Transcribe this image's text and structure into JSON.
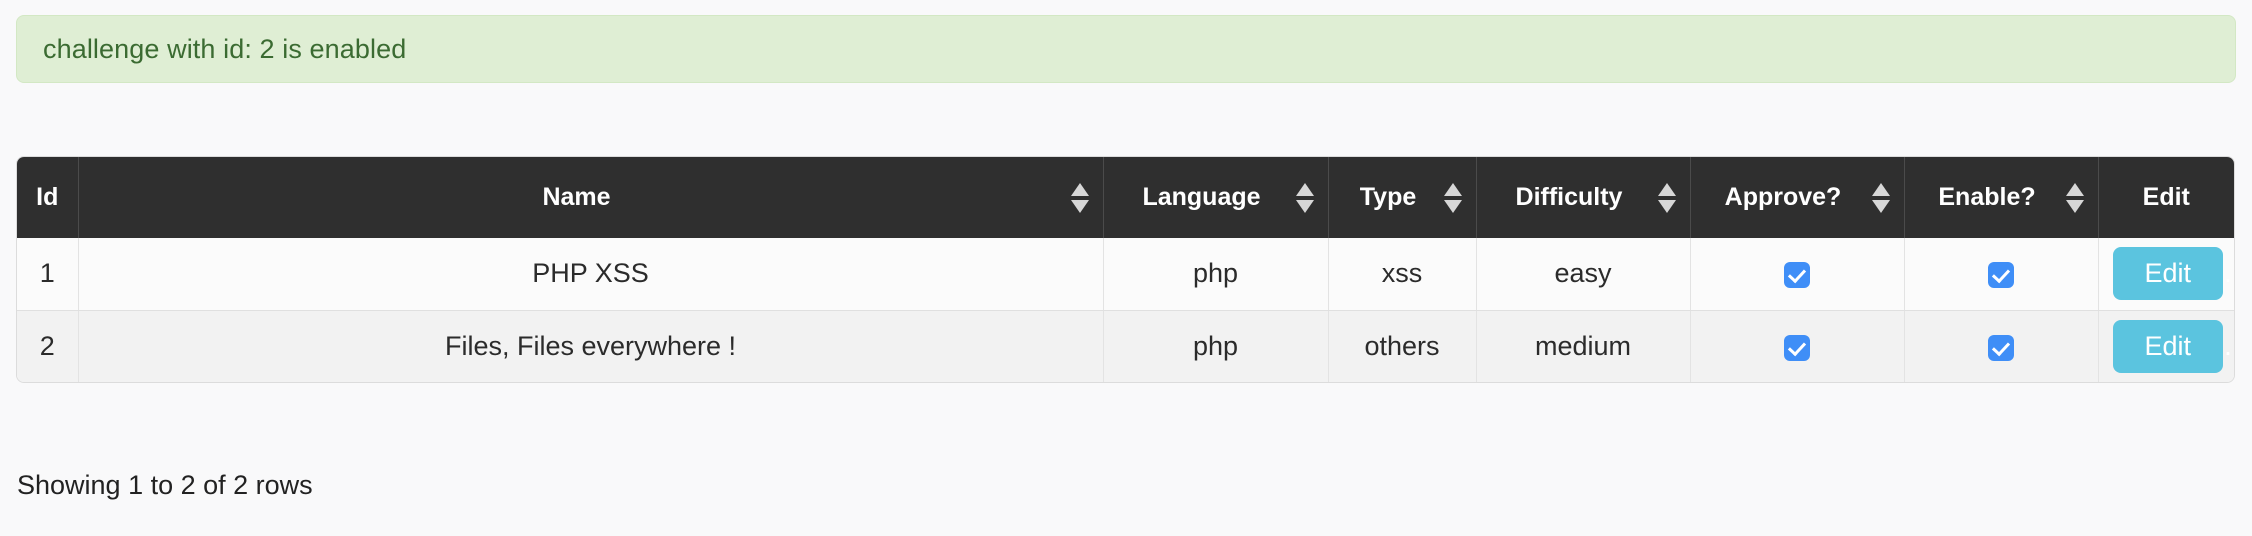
{
  "alert": {
    "message": "challenge with id: 2 is enabled",
    "background_color": "#dfeed4",
    "text_color": "#3b6b32"
  },
  "table": {
    "columns": [
      {
        "key": "id",
        "label": "Id",
        "sortable": false
      },
      {
        "key": "name",
        "label": "Name",
        "sortable": true
      },
      {
        "key": "language",
        "label": "Language",
        "sortable": true
      },
      {
        "key": "type",
        "label": "Type",
        "sortable": true
      },
      {
        "key": "difficulty",
        "label": "Difficulty",
        "sortable": true
      },
      {
        "key": "approve",
        "label": "Approve?",
        "sortable": true
      },
      {
        "key": "enable",
        "label": "Enable?",
        "sortable": true
      },
      {
        "key": "edit",
        "label": "Edit",
        "sortable": false
      }
    ],
    "rows": [
      {
        "id": "1",
        "name": "PHP XSS",
        "language": "php",
        "type": "xss",
        "difficulty": "easy",
        "difficulty_color": "#008000",
        "approve_checked": true,
        "enable_checked": true,
        "edit_label": "Edit"
      },
      {
        "id": "2",
        "name": "Files, Files everywhere !",
        "language": "php",
        "type": "others",
        "difficulty": "medium",
        "difficulty_color": "#f0a03c",
        "approve_checked": true,
        "enable_checked": true,
        "edit_label": "Edit"
      }
    ],
    "header_background": "#2f2f2f",
    "sort_icon": "sort-both-icon"
  },
  "footer": {
    "showing_text": "Showing 1 to 2 of 2 rows"
  },
  "theme": {
    "edit_button_color": "#5bc4df",
    "checkbox_color": "#3f8ef7",
    "page_background": "#f9f9fa"
  }
}
